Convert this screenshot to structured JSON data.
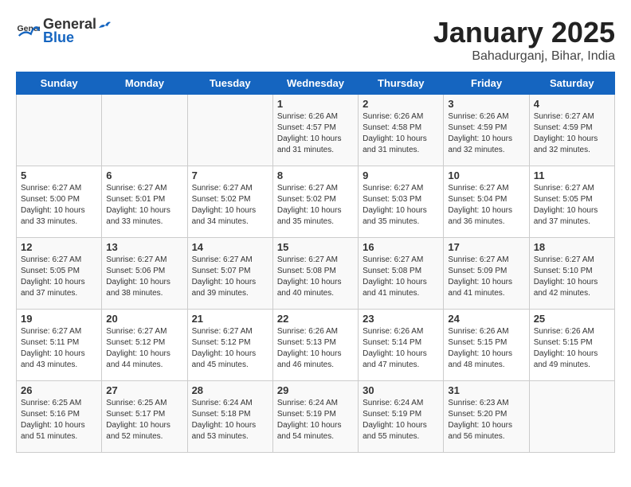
{
  "logo": {
    "text_general": "General",
    "text_blue": "Blue"
  },
  "title": {
    "month_year": "January 2025",
    "location": "Bahadurganj, Bihar, India"
  },
  "days_of_week": [
    "Sunday",
    "Monday",
    "Tuesday",
    "Wednesday",
    "Thursday",
    "Friday",
    "Saturday"
  ],
  "weeks": [
    [
      {
        "day": "",
        "info": ""
      },
      {
        "day": "",
        "info": ""
      },
      {
        "day": "",
        "info": ""
      },
      {
        "day": "1",
        "info": "Sunrise: 6:26 AM\nSunset: 4:57 PM\nDaylight: 10 hours and 31 minutes."
      },
      {
        "day": "2",
        "info": "Sunrise: 6:26 AM\nSunset: 4:58 PM\nDaylight: 10 hours and 31 minutes."
      },
      {
        "day": "3",
        "info": "Sunrise: 6:26 AM\nSunset: 4:59 PM\nDaylight: 10 hours and 32 minutes."
      },
      {
        "day": "4",
        "info": "Sunrise: 6:27 AM\nSunset: 4:59 PM\nDaylight: 10 hours and 32 minutes."
      }
    ],
    [
      {
        "day": "5",
        "info": "Sunrise: 6:27 AM\nSunset: 5:00 PM\nDaylight: 10 hours and 33 minutes."
      },
      {
        "day": "6",
        "info": "Sunrise: 6:27 AM\nSunset: 5:01 PM\nDaylight: 10 hours and 33 minutes."
      },
      {
        "day": "7",
        "info": "Sunrise: 6:27 AM\nSunset: 5:02 PM\nDaylight: 10 hours and 34 minutes."
      },
      {
        "day": "8",
        "info": "Sunrise: 6:27 AM\nSunset: 5:02 PM\nDaylight: 10 hours and 35 minutes."
      },
      {
        "day": "9",
        "info": "Sunrise: 6:27 AM\nSunset: 5:03 PM\nDaylight: 10 hours and 35 minutes."
      },
      {
        "day": "10",
        "info": "Sunrise: 6:27 AM\nSunset: 5:04 PM\nDaylight: 10 hours and 36 minutes."
      },
      {
        "day": "11",
        "info": "Sunrise: 6:27 AM\nSunset: 5:05 PM\nDaylight: 10 hours and 37 minutes."
      }
    ],
    [
      {
        "day": "12",
        "info": "Sunrise: 6:27 AM\nSunset: 5:05 PM\nDaylight: 10 hours and 37 minutes."
      },
      {
        "day": "13",
        "info": "Sunrise: 6:27 AM\nSunset: 5:06 PM\nDaylight: 10 hours and 38 minutes."
      },
      {
        "day": "14",
        "info": "Sunrise: 6:27 AM\nSunset: 5:07 PM\nDaylight: 10 hours and 39 minutes."
      },
      {
        "day": "15",
        "info": "Sunrise: 6:27 AM\nSunset: 5:08 PM\nDaylight: 10 hours and 40 minutes."
      },
      {
        "day": "16",
        "info": "Sunrise: 6:27 AM\nSunset: 5:08 PM\nDaylight: 10 hours and 41 minutes."
      },
      {
        "day": "17",
        "info": "Sunrise: 6:27 AM\nSunset: 5:09 PM\nDaylight: 10 hours and 41 minutes."
      },
      {
        "day": "18",
        "info": "Sunrise: 6:27 AM\nSunset: 5:10 PM\nDaylight: 10 hours and 42 minutes."
      }
    ],
    [
      {
        "day": "19",
        "info": "Sunrise: 6:27 AM\nSunset: 5:11 PM\nDaylight: 10 hours and 43 minutes."
      },
      {
        "day": "20",
        "info": "Sunrise: 6:27 AM\nSunset: 5:12 PM\nDaylight: 10 hours and 44 minutes."
      },
      {
        "day": "21",
        "info": "Sunrise: 6:27 AM\nSunset: 5:12 PM\nDaylight: 10 hours and 45 minutes."
      },
      {
        "day": "22",
        "info": "Sunrise: 6:26 AM\nSunset: 5:13 PM\nDaylight: 10 hours and 46 minutes."
      },
      {
        "day": "23",
        "info": "Sunrise: 6:26 AM\nSunset: 5:14 PM\nDaylight: 10 hours and 47 minutes."
      },
      {
        "day": "24",
        "info": "Sunrise: 6:26 AM\nSunset: 5:15 PM\nDaylight: 10 hours and 48 minutes."
      },
      {
        "day": "25",
        "info": "Sunrise: 6:26 AM\nSunset: 5:15 PM\nDaylight: 10 hours and 49 minutes."
      }
    ],
    [
      {
        "day": "26",
        "info": "Sunrise: 6:25 AM\nSunset: 5:16 PM\nDaylight: 10 hours and 51 minutes."
      },
      {
        "day": "27",
        "info": "Sunrise: 6:25 AM\nSunset: 5:17 PM\nDaylight: 10 hours and 52 minutes."
      },
      {
        "day": "28",
        "info": "Sunrise: 6:24 AM\nSunset: 5:18 PM\nDaylight: 10 hours and 53 minutes."
      },
      {
        "day": "29",
        "info": "Sunrise: 6:24 AM\nSunset: 5:19 PM\nDaylight: 10 hours and 54 minutes."
      },
      {
        "day": "30",
        "info": "Sunrise: 6:24 AM\nSunset: 5:19 PM\nDaylight: 10 hours and 55 minutes."
      },
      {
        "day": "31",
        "info": "Sunrise: 6:23 AM\nSunset: 5:20 PM\nDaylight: 10 hours and 56 minutes."
      },
      {
        "day": "",
        "info": ""
      }
    ]
  ]
}
